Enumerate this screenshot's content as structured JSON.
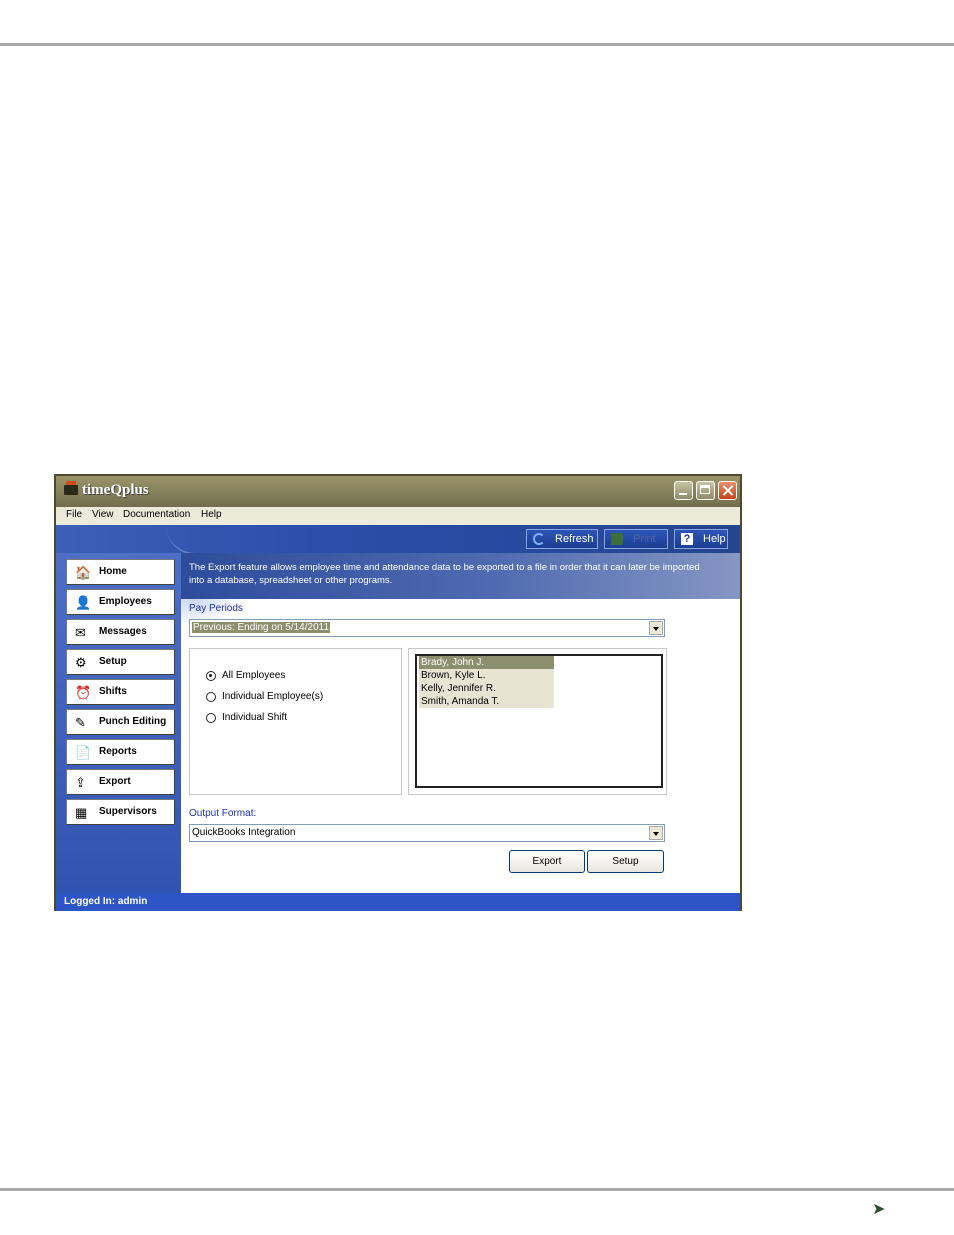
{
  "window": {
    "title": "timeQplus"
  },
  "menu": [
    "File",
    "View",
    "Documentation",
    "Help"
  ],
  "toolbar": {
    "refresh": "Refresh",
    "print": "Print",
    "help": "Help"
  },
  "sidebar": {
    "items": [
      {
        "label": "Home",
        "icon": "home-icon"
      },
      {
        "label": "Employees",
        "icon": "employees-icon"
      },
      {
        "label": "Messages",
        "icon": "messages-icon"
      },
      {
        "label": "Setup",
        "icon": "setup-icon"
      },
      {
        "label": "Shifts",
        "icon": "shifts-icon"
      },
      {
        "label": "Punch Editing",
        "icon": "punch-editing-icon"
      },
      {
        "label": "Reports",
        "icon": "reports-icon"
      },
      {
        "label": "Export",
        "icon": "export-icon"
      },
      {
        "label": "Supervisors",
        "icon": "supervisors-icon"
      }
    ]
  },
  "main": {
    "description": "The Export feature allows employee time and attendance data to be exported to a file in order that it can later be imported into a database, spreadsheet or other programs.",
    "pay_periods_label": "Pay Periods",
    "pay_period_value": "Previous:  Ending on 5/14/2011",
    "options": [
      {
        "label": "All Employees",
        "checked": true
      },
      {
        "label": "Individual Employee(s)",
        "checked": false
      },
      {
        "label": "Individual Shift",
        "checked": false
      }
    ],
    "employees": [
      "Brady, John J.",
      "Brown, Kyle L.",
      "Kelly, Jennifer R.",
      "Smith, Amanda T."
    ],
    "selected_employee": "Brady, John J.",
    "output_format_label": "Output Format:",
    "output_format_value": "QuickBooks Integration",
    "export_button": "Export",
    "setup_button": "Setup"
  },
  "status": {
    "text": "Logged In: admin"
  },
  "colors": {
    "accent": "#2e55c7",
    "titlebar": "#8c8a62",
    "selection": "#8c8f6e"
  }
}
